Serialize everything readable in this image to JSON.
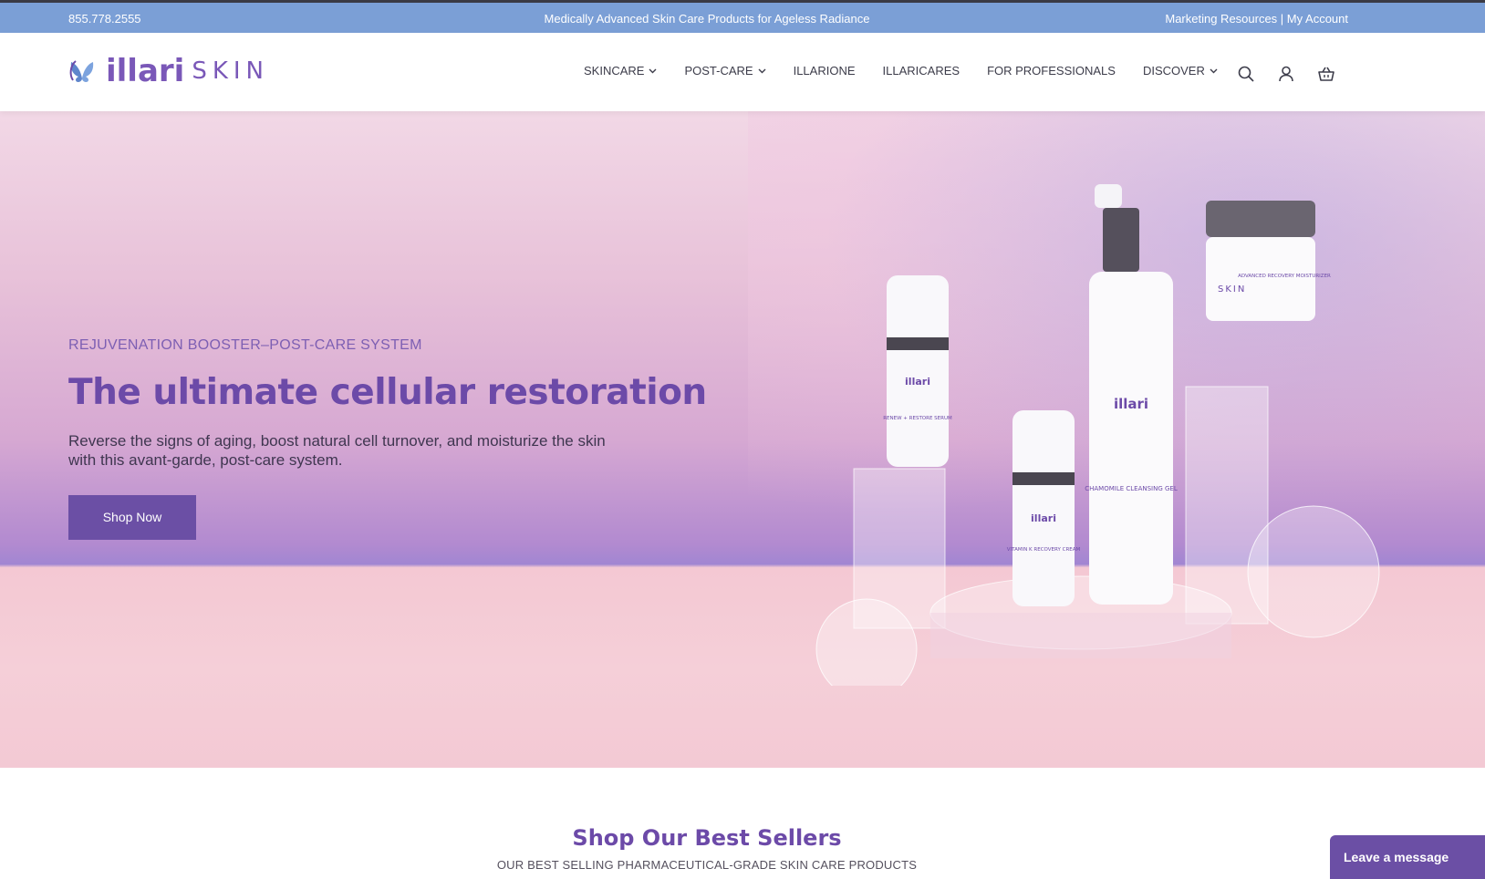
{
  "announcement": {
    "phone": "855.778.2555",
    "tagline": "Medically Advanced Skin Care Products for Ageless Radiance",
    "marketing": "Marketing Resources",
    "separator": " | ",
    "account": "My Account"
  },
  "header": {
    "logo_text": "illari",
    "logo_sub": "SKIN",
    "nav": [
      {
        "label": "SKINCARE",
        "dropdown": true
      },
      {
        "label": "POST-CARE",
        "dropdown": true
      },
      {
        "label": "ILLARIONE",
        "dropdown": false
      },
      {
        "label": "ILLARICARES",
        "dropdown": false
      },
      {
        "label": "FOR PROFESSIONALS",
        "dropdown": false
      },
      {
        "label": "DISCOVER",
        "dropdown": true
      }
    ],
    "icons": [
      "search-icon",
      "account-icon",
      "cart-icon"
    ]
  },
  "hero": {
    "eyebrow": "REJUVENATION BOOSTER–POST-CARE SYSTEM",
    "headline": "The ultimate cellular restoration",
    "subtext": "Reverse the signs of aging, boost natural cell turnover, and moisturize the skin with this avant-garde, post-care system.",
    "cta": "Shop Now",
    "products": {
      "brand": "illari",
      "brand_sub": "SKIN",
      "serum": "RENEW + RESTORE SERUM",
      "cream": "VITAMIN K RECOVERY CREAM",
      "gel": "CHAMOMILE CLEANSING GEL",
      "moisturizer": "ADVANCED RECOVERY MOISTURIZER"
    }
  },
  "best_sellers": {
    "title": "Shop Our Best Sellers",
    "subtitle": "OUR BEST SELLING PHARMACEUTICAL-GRADE SKIN CARE PRODUCTS"
  },
  "chat": {
    "label": "Leave a message"
  },
  "colors": {
    "brand_purple": "#6c4aa8",
    "announce_bar": "#7b9fd6",
    "button": "#6b4fa5"
  }
}
